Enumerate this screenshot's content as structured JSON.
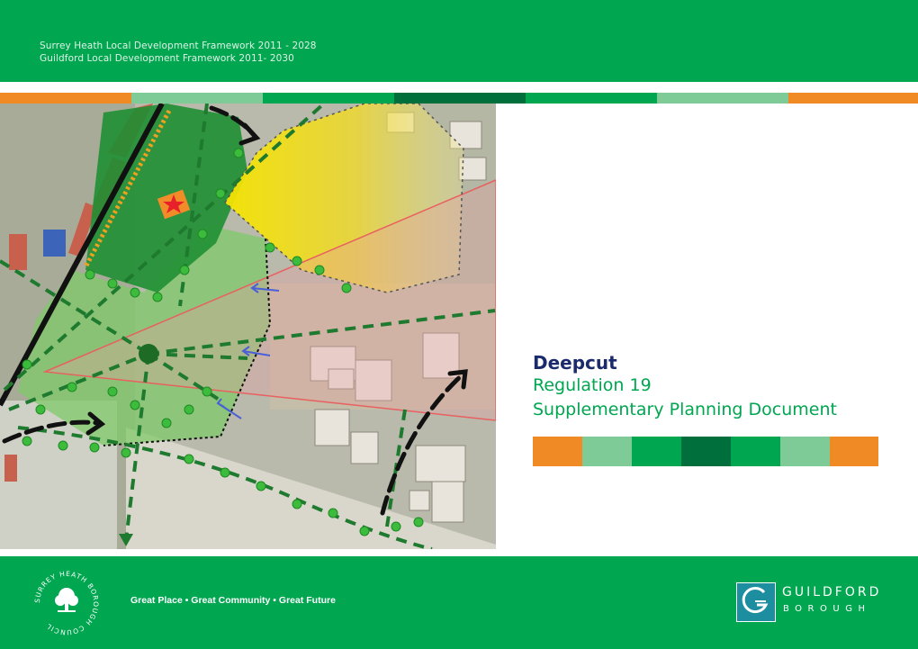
{
  "header": {
    "line1": "Surrey Heath Local Development Framework 2011 - 2028",
    "line2": "Guildford Local Development Framework 2011- 2030"
  },
  "colors": {
    "brand_green": "#00a650",
    "dark_green": "#006f3c",
    "light_green": "#7ecb98",
    "orange": "#f08a24",
    "teal": "#1c8ea0"
  },
  "stripe_colors": [
    "#f08a24",
    "#7ecb98",
    "#00a650",
    "#006f3c",
    "#00a650",
    "#7ecb98",
    "#f08a24"
  ],
  "title": {
    "place": "Deepcut",
    "line2": "Regulation 19",
    "line3": "Supplementary Planning Document"
  },
  "footer": {
    "tagline": "Great Place • Great Community • Great Future",
    "left_logo_text": "SURREY HEATH BOROUGH COUNCIL",
    "right_logo": {
      "line1": "GUILDFORD",
      "line2": "BOROUGH"
    }
  },
  "map_image": {
    "icons": [
      "star-icon",
      "node-icon",
      "arrow-icon"
    ]
  }
}
